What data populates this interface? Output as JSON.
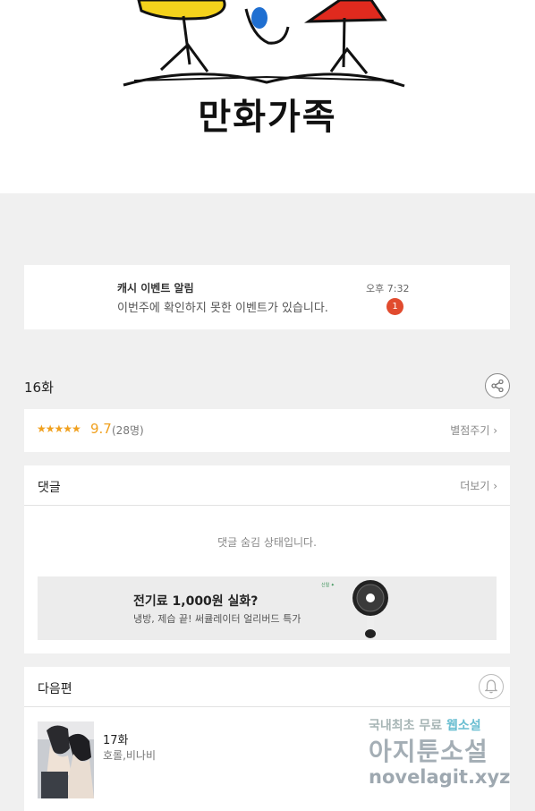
{
  "header": {
    "logo_text": "만화가족"
  },
  "notice": {
    "title": "캐시 이벤트 알림",
    "message": "이번주에 확인하지 못한 이벤트가 있습니다.",
    "time": "오후 7:32",
    "badge_count": "1"
  },
  "episode": {
    "title": "16화",
    "share_icon": "share-icon"
  },
  "rating": {
    "stars": "★★★★★",
    "score": "9.7",
    "count": "(28명)",
    "rate_label": "별점주기 ›"
  },
  "comments": {
    "title": "댓글",
    "more_label": "더보기 ›",
    "hidden_message": "댓글 숨김 상태입니다."
  },
  "ad": {
    "title": "전기료 1,000원 실화?",
    "subtitle": "냉방, 제습 끝! 써큘레이터 얼리버드 특가",
    "brand": "신일 ✦"
  },
  "next_episode": {
    "section_title": "다음편",
    "episode_title": "17화",
    "author": "호롤,비나비",
    "bell_icon": "bell-icon"
  },
  "watermark": {
    "line1_prefix": "국내최초 무료 ",
    "line1_highlight": "웹소설",
    "line2": "아지툰소설",
    "line3": "novelagit.xyz"
  },
  "colors": {
    "background": "#f0f0f0",
    "accent_star": "#f0a01e",
    "badge": "#e14b2e"
  }
}
